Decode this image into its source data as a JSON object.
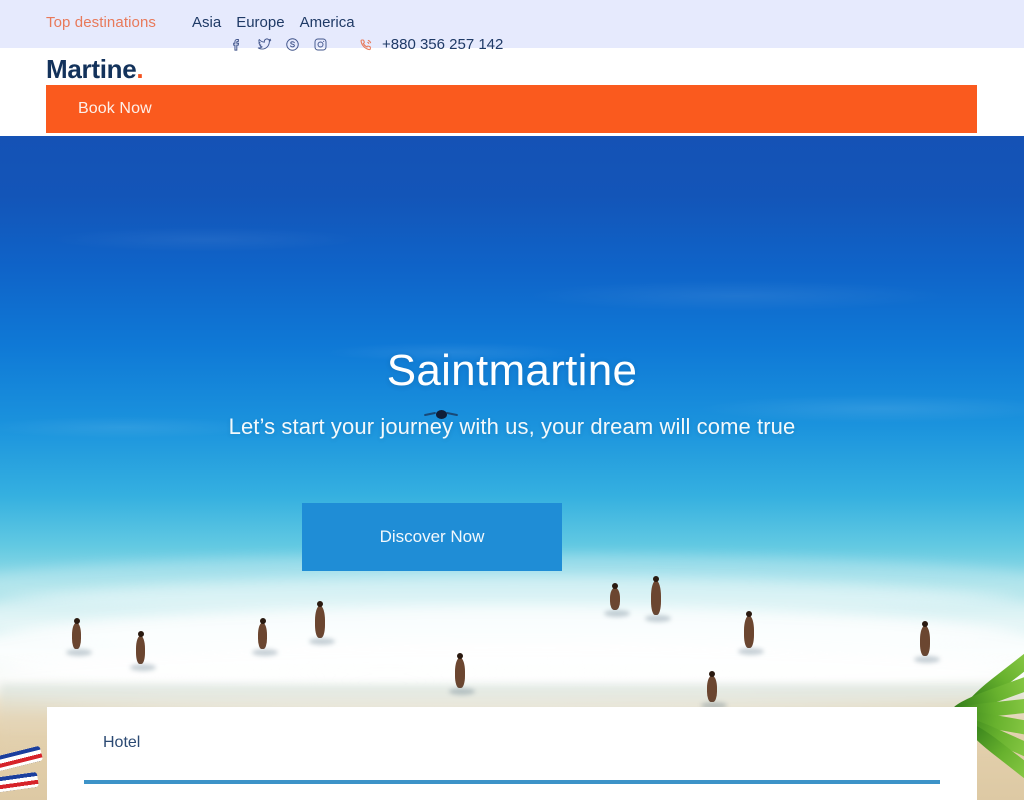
{
  "topbar": {
    "promo_label": "Top destinations",
    "nav_links": [
      {
        "label": "Asia"
      },
      {
        "label": "Europe"
      },
      {
        "label": "America"
      }
    ],
    "social": [
      {
        "name": "facebook-icon"
      },
      {
        "name": "twitter-icon"
      },
      {
        "name": "skype-icon"
      },
      {
        "name": "instagram-icon"
      }
    ],
    "phone_number": "+880 356 257 142",
    "bg_color": "#e6eafd",
    "promo_color": "#e8795a",
    "link_color": "#1f3a66"
  },
  "header": {
    "logo_text": "Martine",
    "logo_dot": ".",
    "logo_color": "#13325b",
    "logo_dot_color": "#f4511e",
    "book_now_label": "Book Now",
    "band_color": "#fa5a1e"
  },
  "hero": {
    "title": "Saintmartine",
    "subtitle": "Let’s start your journey with us, your dream will come true",
    "cta_label": "Discover Now",
    "cta_color": "#1f8dd6",
    "title_color": "#ffffff"
  },
  "booking": {
    "field_label": "Hotel",
    "label_color": "#2c4a73",
    "underline_color": "#3d93c8"
  }
}
